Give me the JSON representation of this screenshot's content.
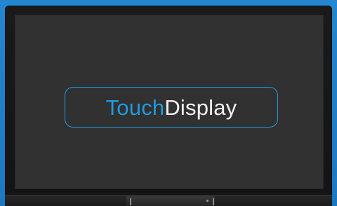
{
  "logo": {
    "part1": "Touch",
    "part2": "Display",
    "accent_color": "#1e9be0",
    "text_color": "#f2f2f2"
  },
  "colors": {
    "background": "#1f7fc8",
    "bezel": "#1a1a1b",
    "screen": "#313131"
  }
}
